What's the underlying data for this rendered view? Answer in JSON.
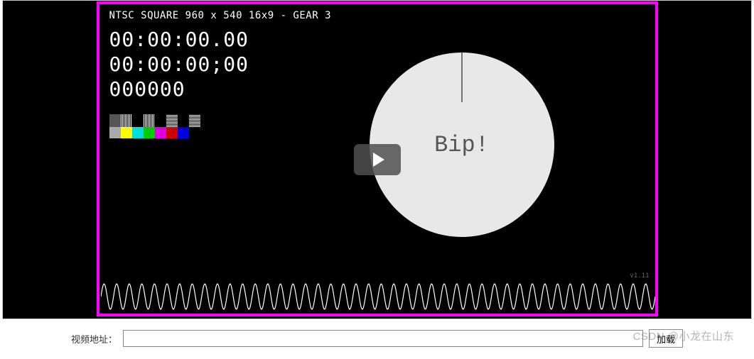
{
  "video": {
    "header": "NTSC SQUARE  960 x 540  16x9  -  GEAR 3",
    "timecode1": "00:00:00.00",
    "timecode2": "00:00:00;00",
    "framecount": "000000",
    "circle_text": "Bip!",
    "version": "v1.11"
  },
  "colorbars": {
    "row1": [
      "#555",
      "#fff",
      "#000",
      "#fff",
      "#000",
      "#fff",
      "#000",
      "#fff"
    ],
    "row2": [
      "#aaa",
      "#ffff00",
      "#00dddd",
      "#00cc00",
      "#dd00dd",
      "#cc0000",
      "#0000dd",
      "#000"
    ]
  },
  "controls": {
    "label": "视频地址：",
    "value": "",
    "placeholder": "",
    "button": "加载"
  },
  "watermark": "CSDN @小龙在山东"
}
